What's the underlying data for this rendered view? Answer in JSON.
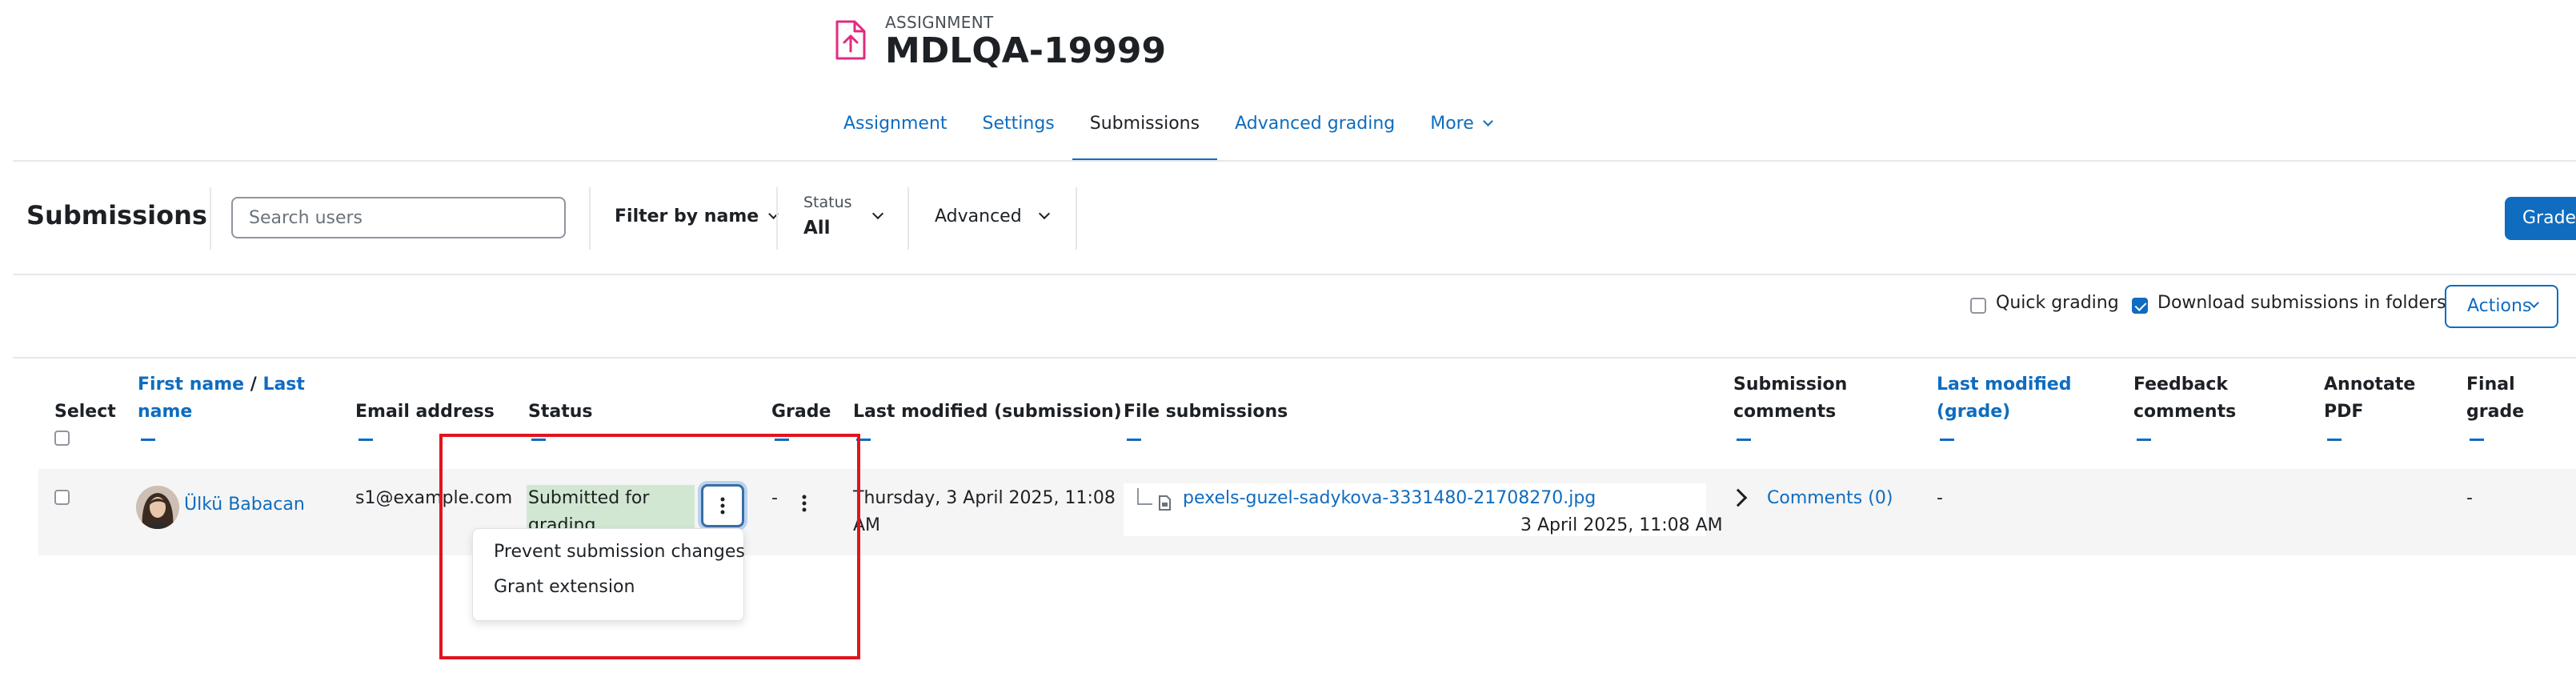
{
  "header": {
    "kicker": "ASSIGNMENT",
    "title": "MDLQA-19999",
    "tabs": [
      {
        "label": "Assignment"
      },
      {
        "label": "Settings"
      },
      {
        "label": "Submissions"
      },
      {
        "label": "Advanced grading"
      },
      {
        "label": "More"
      }
    ],
    "icon": "assignment-file-upload-icon"
  },
  "toolbar": {
    "title": "Submissions",
    "search_placeholder": "Search users",
    "filter_by_name": "Filter by name",
    "status_caption": "Status",
    "status_value": "All",
    "advanced": "Advanced",
    "grade_button": "Grade"
  },
  "options": {
    "quick_grading": "Quick grading",
    "quick_grading_checked": false,
    "download_in_folders": "Download submissions in folders",
    "download_in_folders_checked": true,
    "actions_button": "Actions"
  },
  "table": {
    "headers": {
      "select": "Select",
      "first_name": "First name",
      "slash": "/",
      "last_name_1": "Last",
      "last_name_2": "name",
      "email": "Email address",
      "status": "Status",
      "grade": "Grade",
      "last_modified_submission": "Last modified (submission)",
      "file_submissions": "File submissions",
      "submission_comments_1": "Submission",
      "submission_comments_2": "comments",
      "last_modified_grade_1": "Last modified",
      "last_modified_grade_2": "(grade)",
      "feedback_comments_1": "Feedback",
      "feedback_comments_2": "comments",
      "annotate_pdf_1": "Annotate",
      "annotate_pdf_2": "PDF",
      "final_grade_1": "Final",
      "final_grade_2": "grade"
    },
    "rows": [
      {
        "name": "Ülkü Babacan",
        "email": "s1@example.com",
        "status_1": "Submitted for",
        "status_2": "grading",
        "grade": "-",
        "last_modified_1": "Thursday, 3 April 2025, 11:08",
        "last_modified_2": "AM",
        "file_name": "pexels-guzel-sadykova-3331480-21708270.jpg",
        "file_date": "3 April 2025, 11:08 AM",
        "comments": "Comments (0)",
        "last_modified_grade": "-",
        "final_grade": "-"
      }
    ]
  },
  "menu": {
    "items": [
      {
        "label": "Prevent submission changes"
      },
      {
        "label": "Grant extension"
      }
    ]
  },
  "colors": {
    "link": "#0f6cbf",
    "primary_button": "#0f6cbf",
    "status_badge": "#d1e7d1",
    "highlight": "#e0141e",
    "assignment_icon": "#e02b80"
  }
}
